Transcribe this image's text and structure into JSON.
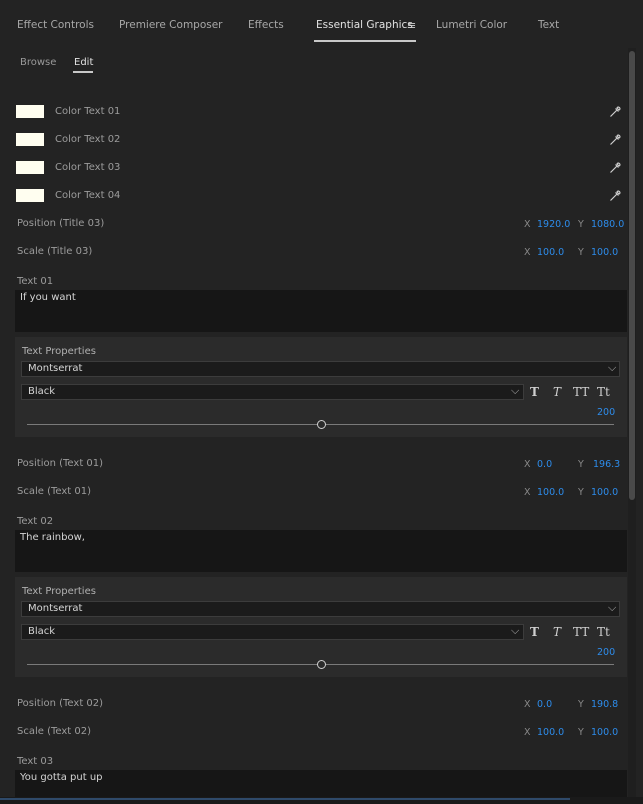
{
  "tabs": {
    "effect_controls": "Effect Controls",
    "premiere_composer": "Premiere Composer",
    "effects": "Effects",
    "essential_graphics": "Essential Graphics",
    "menu_glyph": "≡",
    "lumetri_color": "Lumetri Color",
    "text": "Text"
  },
  "subtabs": {
    "browse": "Browse",
    "edit": "Edit"
  },
  "colors": {
    "swatch": "#fffef0",
    "accent_blue": "#2d8ceb",
    "panel_bg": "#232323"
  },
  "color_rows": [
    {
      "label": "Color Text 01",
      "icon": "eyedropper-icon"
    },
    {
      "label": "Color Text 02",
      "icon": "eyedropper-icon"
    },
    {
      "label": "Color Text 03",
      "icon": "eyedropper-icon"
    },
    {
      "label": "Color Text 04",
      "icon": "eyedropper-icon"
    }
  ],
  "title03": {
    "position_label": "Position (Title 03)",
    "position_x": "1920.0",
    "position_y": "1080.0",
    "scale_label": "Scale (Title 03)",
    "scale_x": "100.0",
    "scale_y": "100.0"
  },
  "axis": {
    "x": "X",
    "y": "Y"
  },
  "text01": {
    "label": "Text 01",
    "value": "If you want",
    "props_title": "Text Properties",
    "font": "Montserrat",
    "style": "Black",
    "size": "200",
    "position_label": "Position (Text 01)",
    "position_x": "0.0",
    "position_y": "196.3",
    "scale_label": "Scale (Text 01)",
    "scale_x": "100.0",
    "scale_y": "100.0"
  },
  "text02": {
    "label": "Text 02",
    "value": "The rainbow,",
    "props_title": "Text Properties",
    "font": "Montserrat",
    "style": "Black",
    "size": "200",
    "position_label": "Position (Text 02)",
    "position_x": "0.0",
    "position_y": "190.8",
    "scale_label": "Scale (Text 02)",
    "scale_x": "100.0",
    "scale_y": "100.0"
  },
  "text03": {
    "label": "Text 03",
    "value": "You gotta put up"
  },
  "format_buttons": {
    "bold": "T",
    "italic": "T",
    "all_caps": "TT",
    "small_caps": "Tt"
  },
  "chevron": "⌵"
}
